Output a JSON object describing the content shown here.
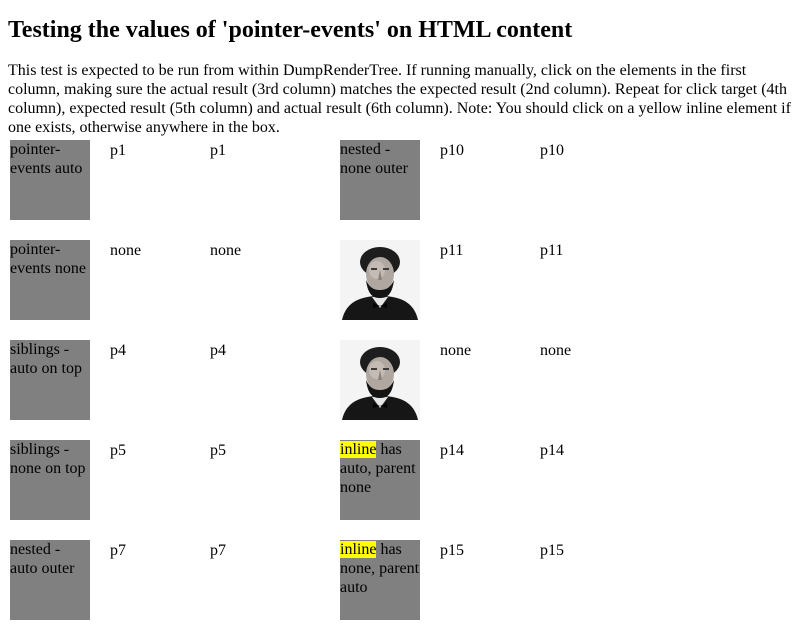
{
  "heading": "Testing the values of 'pointer-events' on HTML content",
  "description": "This test is expected to be run from within DumpRenderTree. If running manually, click on the elements in the first column, making sure the actual result (3rd column) matches the expected result (2nd column). Repeat for click target (4th column), expected result (5th column) and actual result (6th column). Note: You should click on a yellow inline element if one exists, otherwise anywhere in the box.",
  "left_rows": [
    {
      "label": "pointer-events auto",
      "expected": "p1",
      "actual": "p1"
    },
    {
      "label": "pointer-events none",
      "expected": "none",
      "actual": "none"
    },
    {
      "label": "siblings - auto on top",
      "expected": "p4",
      "actual": "p4"
    },
    {
      "label": "siblings - none on top",
      "expected": "p5",
      "actual": "p5"
    },
    {
      "label": "nested - auto outer",
      "expected": "p7",
      "actual": "p7"
    }
  ],
  "right_rows": [
    {
      "kind": "box",
      "label": "nested - none outer",
      "expected": "p10",
      "actual": "p10"
    },
    {
      "kind": "image",
      "image": "portrait-photo",
      "expected": "p11",
      "actual": "p11"
    },
    {
      "kind": "image",
      "image": "portrait-photo",
      "expected": "none",
      "actual": "none"
    },
    {
      "kind": "inline",
      "inline_word": "inline",
      "label_rest": " has auto, parent none",
      "expected": "p14",
      "actual": "p14"
    },
    {
      "kind": "inline",
      "inline_word": "inline",
      "label_rest": " has none, parent auto",
      "expected": "p15",
      "actual": "p15"
    }
  ],
  "colors": {
    "box": "#808080",
    "highlight": "#ffff00",
    "background": "#ffffff"
  }
}
